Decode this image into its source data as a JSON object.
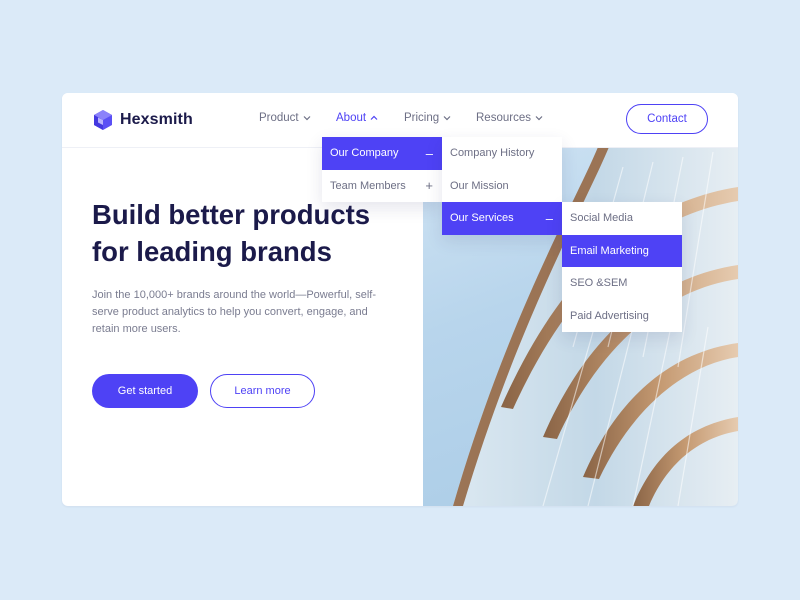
{
  "brand": {
    "name": "Hexsmith",
    "accent": "#4e42f5",
    "text_dark": "#1b1a4a"
  },
  "nav": {
    "items": [
      {
        "label": "Product",
        "icon": "chevron-down-icon"
      },
      {
        "label": "About",
        "icon": "chevron-up-icon",
        "active": true
      },
      {
        "label": "Pricing",
        "icon": "chevron-down-icon"
      },
      {
        "label": "Resources",
        "icon": "chevron-down-icon"
      }
    ],
    "contact_label": "Contact"
  },
  "hero": {
    "headline_line1": "Build better products",
    "headline_line2": "for leading brands",
    "subtitle": "Join the 10,000+ brands around the world—Powerful, self-serve product analytics to help you convert, engage, and retain more users.",
    "primary_cta": "Get started",
    "secondary_cta": "Learn more"
  },
  "menus": {
    "level1": [
      {
        "label": "Our Company",
        "sign": "–",
        "active": true
      },
      {
        "label": "Team Members",
        "sign": "+"
      }
    ],
    "level2": [
      {
        "label": "Company History"
      },
      {
        "label": "Our Mission"
      },
      {
        "label": "Our Services",
        "sign": "–",
        "active": true
      }
    ],
    "level3": [
      {
        "label": "Social Media"
      },
      {
        "label": "Email Marketing",
        "active": true
      },
      {
        "label": "SEO &SEM"
      },
      {
        "label": "Paid Advertising"
      }
    ]
  }
}
